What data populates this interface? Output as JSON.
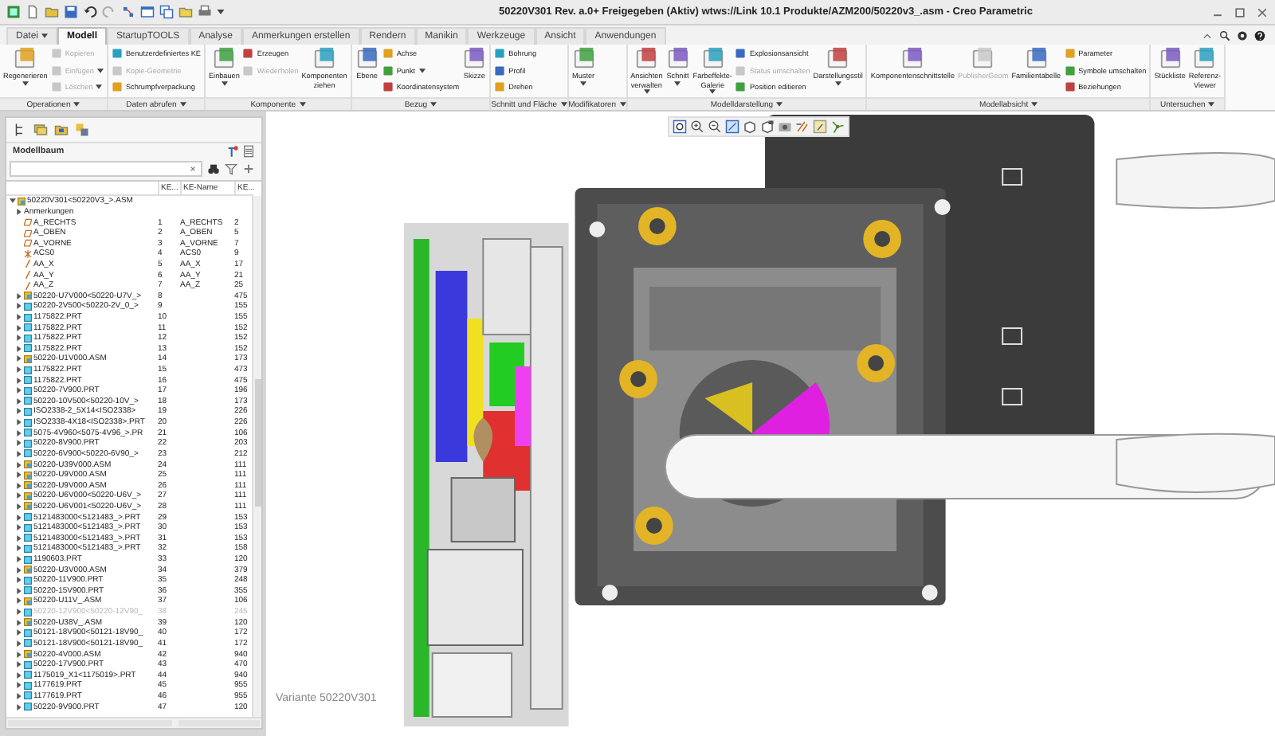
{
  "window": {
    "title": "50220V301 Rev. a.0+ Freigegeben (Aktiv) wtws://Link 10.1 Produkte/AZM200/50220v3_.asm - Creo Parametric"
  },
  "tabs": [
    {
      "label": "Datei",
      "selected": false,
      "dropdown": true
    },
    {
      "label": "Modell",
      "selected": true,
      "dropdown": false
    },
    {
      "label": "StartupTOOLS",
      "selected": false,
      "dropdown": false
    },
    {
      "label": "Analyse",
      "selected": false,
      "dropdown": false
    },
    {
      "label": "Anmerkungen erstellen",
      "selected": false,
      "dropdown": false
    },
    {
      "label": "Rendern",
      "selected": false,
      "dropdown": false
    },
    {
      "label": "Manikin",
      "selected": false,
      "dropdown": false
    },
    {
      "label": "Werkzeuge",
      "selected": false,
      "dropdown": false
    },
    {
      "label": "Ansicht",
      "selected": false,
      "dropdown": false
    },
    {
      "label": "Anwendungen",
      "selected": false,
      "dropdown": false
    }
  ],
  "ribbon": {
    "groups": [
      {
        "label": "Operationen",
        "commands": [
          {
            "label": "Regenerieren",
            "kind": "large",
            "disabled": false,
            "dropdown": true
          },
          {
            "label": "Kopieren",
            "kind": "small",
            "disabled": true,
            "dropdown": false
          },
          {
            "label": "Einfügen",
            "kind": "small",
            "disabled": true,
            "dropdown": true
          },
          {
            "label": "Löschen",
            "kind": "small",
            "disabled": true,
            "dropdown": true
          }
        ]
      },
      {
        "label": "Daten abrufen",
        "commands": [
          {
            "label": "Benutzerdefiniertes KE",
            "kind": "small",
            "disabled": false,
            "dropdown": false
          },
          {
            "label": "Kopie-Geometrie",
            "kind": "small",
            "disabled": true,
            "dropdown": false
          },
          {
            "label": "Schrumpfverpackung",
            "kind": "small",
            "disabled": false,
            "dropdown": false
          }
        ]
      },
      {
        "label": "Komponente",
        "commands": [
          {
            "label": "Einbauen",
            "kind": "large",
            "disabled": false,
            "dropdown": true
          },
          {
            "label": "Erzeugen",
            "kind": "small",
            "disabled": false,
            "dropdown": false
          },
          {
            "label": "Wiederholen",
            "kind": "small",
            "disabled": true,
            "dropdown": false
          },
          {
            "label": "Komponenten ziehen",
            "kind": "large",
            "disabled": false,
            "dropdown": false
          }
        ]
      },
      {
        "label": "Bezug",
        "commands": [
          {
            "label": "Ebene",
            "kind": "large",
            "disabled": false,
            "dropdown": false
          },
          {
            "label": "Achse",
            "kind": "small",
            "disabled": false,
            "dropdown": false
          },
          {
            "label": "Punkt",
            "kind": "small",
            "disabled": false,
            "dropdown": true
          },
          {
            "label": "Koordinatensystem",
            "kind": "small",
            "disabled": false,
            "dropdown": false
          },
          {
            "label": "Skizze",
            "kind": "large",
            "disabled": false,
            "dropdown": false
          }
        ]
      },
      {
        "label": "Schnitt und Fläche",
        "commands": [
          {
            "label": "Bohrung",
            "kind": "small",
            "disabled": false,
            "dropdown": false
          },
          {
            "label": "Profil",
            "kind": "small",
            "disabled": false,
            "dropdown": false
          },
          {
            "label": "Drehen",
            "kind": "small",
            "disabled": false,
            "dropdown": false
          }
        ]
      },
      {
        "label": "Modifikatoren",
        "commands": [
          {
            "label": "Muster",
            "kind": "large",
            "disabled": false,
            "dropdown": true
          }
        ]
      },
      {
        "label": "Modelldarstellung",
        "commands": [
          {
            "label": "Ansichten verwalten",
            "kind": "large",
            "disabled": false,
            "dropdown": true
          },
          {
            "label": "Schnitt",
            "kind": "large",
            "disabled": false,
            "dropdown": true
          },
          {
            "label": "Farbeffekte-Galerie",
            "kind": "large",
            "disabled": false,
            "dropdown": true
          },
          {
            "label": "Explosionsansicht",
            "kind": "small",
            "disabled": false,
            "dropdown": false
          },
          {
            "label": "Status umschalten",
            "kind": "small",
            "disabled": true,
            "dropdown": false
          },
          {
            "label": "Position editieren",
            "kind": "small",
            "disabled": false,
            "dropdown": false
          },
          {
            "label": "Darstellungsstil",
            "kind": "large",
            "disabled": false,
            "dropdown": true
          }
        ]
      },
      {
        "label": "Modellabsicht",
        "commands": [
          {
            "label": "Komponentenschnittstelle",
            "kind": "large",
            "disabled": false,
            "dropdown": false
          },
          {
            "label": "PublisherGeom",
            "kind": "large",
            "disabled": true,
            "dropdown": false
          },
          {
            "label": "Familientabelle",
            "kind": "large",
            "disabled": false,
            "dropdown": false
          },
          {
            "label": "Parameter",
            "kind": "small",
            "disabled": false,
            "dropdown": false
          },
          {
            "label": "Symbole umschalten",
            "kind": "small",
            "disabled": false,
            "dropdown": false
          },
          {
            "label": "Beziehungen",
            "kind": "small",
            "disabled": false,
            "dropdown": false
          }
        ]
      },
      {
        "label": "Untersuchen",
        "commands": [
          {
            "label": "Stückliste",
            "kind": "large",
            "disabled": false,
            "dropdown": false
          },
          {
            "label": "Referenz-Viewer",
            "kind": "large",
            "disabled": false,
            "dropdown": false
          }
        ]
      }
    ]
  },
  "model_tree": {
    "title": "Modellbaum",
    "columns": [
      "KE...",
      "KE-Name",
      "KE..."
    ],
    "root": {
      "kind": "asm",
      "label": "50220V301<50220V3_>.ASM",
      "expanded": true,
      "dimmed": false,
      "children": [
        {
          "kind": "folder",
          "label": "Anmerkungen",
          "expanded": false,
          "dimmed": false
        },
        {
          "kind": "plane",
          "label": "A_RECHTS",
          "number": "1",
          "feature_name": "A_RECHTS",
          "column_3": "2",
          "dimmed": false
        },
        {
          "kind": "plane",
          "label": "A_OBEN",
          "number": "2",
          "feature_name": "A_OBEN",
          "column_3": "5",
          "dimmed": false
        },
        {
          "kind": "plane",
          "label": "A_VORNE",
          "number": "3",
          "feature_name": "A_VORNE",
          "column_3": "7",
          "dimmed": false
        },
        {
          "kind": "csys",
          "label": "ACS0",
          "number": "4",
          "feature_name": "ACS0",
          "column_3": "9",
          "dimmed": false
        },
        {
          "kind": "axis",
          "label": "AA_X",
          "number": "5",
          "feature_name": "AA_X",
          "column_3": "17",
          "dimmed": false
        },
        {
          "kind": "axis",
          "label": "AA_Y",
          "number": "6",
          "feature_name": "AA_Y",
          "column_3": "21",
          "dimmed": false
        },
        {
          "kind": "axis",
          "label": "AA_Z",
          "number": "7",
          "feature_name": "AA_Z",
          "column_3": "25",
          "dimmed": false
        },
        {
          "kind": "asm",
          "label": "50220-U7V000<50220-U7V_>",
          "number": "8",
          "column_3": "475",
          "expanded": false,
          "dimmed": false
        },
        {
          "kind": "prt",
          "label": "50220-2V500<50220-2V_0_>",
          "number": "9",
          "column_3": "155",
          "expanded": false,
          "dimmed": false
        },
        {
          "kind": "prt",
          "label": "1175822.PRT",
          "number": "10",
          "column_3": "155",
          "expanded": false,
          "dimmed": false
        },
        {
          "kind": "prt",
          "label": "1175822.PRT",
          "number": "11",
          "column_3": "152",
          "expanded": false,
          "dimmed": false
        },
        {
          "kind": "prt",
          "label": "1175822.PRT",
          "number": "12",
          "column_3": "152",
          "expanded": false,
          "dimmed": false
        },
        {
          "kind": "prt",
          "label": "1175822.PRT",
          "number": "13",
          "column_3": "152",
          "expanded": false,
          "dimmed": false
        },
        {
          "kind": "asm",
          "label": "50220-U1V000.ASM",
          "number": "14",
          "column_3": "173",
          "expanded": false,
          "dimmed": false
        },
        {
          "kind": "prt",
          "label": "1175822.PRT",
          "number": "15",
          "column_3": "473",
          "expanded": false,
          "dimmed": false
        },
        {
          "kind": "prt",
          "label": "1175822.PRT",
          "number": "16",
          "column_3": "475",
          "expanded": false,
          "dimmed": false
        },
        {
          "kind": "prt",
          "label": "50220-7V900.PRT",
          "number": "17",
          "column_3": "196",
          "expanded": false,
          "dimmed": false
        },
        {
          "kind": "prt",
          "label": "50220-10V500<50220-10V_>",
          "number": "18",
          "column_3": "173",
          "expanded": false,
          "dimmed": false
        },
        {
          "kind": "prt",
          "label": "ISO2338-2_5X14<ISO2338>",
          "number": "19",
          "column_3": "226",
          "expanded": false,
          "dimmed": false
        },
        {
          "kind": "prt",
          "label": "ISO2338-4X18<ISO2338>.PRT",
          "number": "20",
          "column_3": "226",
          "expanded": false,
          "dimmed": false
        },
        {
          "kind": "prt",
          "label": "5075-4V960<5075-4V96_>.PR",
          "number": "21",
          "column_3": "106",
          "expanded": false,
          "dimmed": false
        },
        {
          "kind": "prt",
          "label": "50220-8V900.PRT",
          "number": "22",
          "column_3": "203",
          "expanded": false,
          "dimmed": false
        },
        {
          "kind": "prt",
          "label": "50220-6V900<50220-6V90_>",
          "number": "23",
          "column_3": "212",
          "expanded": false,
          "dimmed": false
        },
        {
          "kind": "asm",
          "label": "50220-U39V000.ASM",
          "number": "24",
          "column_3": "111",
          "expanded": false,
          "dimmed": false
        },
        {
          "kind": "asm",
          "label": "50220-U9V000.ASM",
          "number": "25",
          "column_3": "111",
          "expanded": false,
          "dimmed": false
        },
        {
          "kind": "asm",
          "label": "50220-U9V000.ASM",
          "number": "26",
          "column_3": "111",
          "expanded": false,
          "dimmed": false
        },
        {
          "kind": "asm",
          "label": "50220-U6V000<50220-U6V_>",
          "number": "27",
          "column_3": "111",
          "expanded": false,
          "dimmed": false
        },
        {
          "kind": "asm",
          "label": "50220-U6V001<50220-U6V_>",
          "number": "28",
          "column_3": "111",
          "expanded": false,
          "dimmed": false
        },
        {
          "kind": "prt",
          "label": "5121483000<5121483_>.PRT",
          "number": "29",
          "column_3": "153",
          "expanded": false,
          "dimmed": false
        },
        {
          "kind": "prt",
          "label": "5121483000<5121483_>.PRT",
          "number": "30",
          "column_3": "153",
          "expanded": false,
          "dimmed": false
        },
        {
          "kind": "prt",
          "label": "5121483000<5121483_>.PRT",
          "number": "31",
          "column_3": "153",
          "expanded": false,
          "dimmed": false
        },
        {
          "kind": "prt",
          "label": "5121483000<5121483_>.PRT",
          "number": "32",
          "column_3": "158",
          "expanded": false,
          "dimmed": false
        },
        {
          "kind": "prt",
          "label": "1190603.PRT",
          "number": "33",
          "column_3": "120",
          "expanded": false,
          "dimmed": false
        },
        {
          "kind": "asm",
          "label": "50220-U3V000.ASM",
          "number": "34",
          "column_3": "379",
          "expanded": false,
          "dimmed": false
        },
        {
          "kind": "prt",
          "label": "50220-11V900.PRT",
          "number": "35",
          "column_3": "248",
          "expanded": false,
          "dimmed": false
        },
        {
          "kind": "prt",
          "label": "50220-15V900.PRT",
          "number": "36",
          "column_3": "355",
          "expanded": false,
          "dimmed": false
        },
        {
          "kind": "asm",
          "label": "50220-U11V_.ASM",
          "number": "37",
          "column_3": "106",
          "expanded": false,
          "dimmed": false
        },
        {
          "kind": "prt",
          "label": "50220-12V900<50220-12V90_",
          "number": "38",
          "column_3": "245",
          "expanded": false,
          "dimmed": true
        },
        {
          "kind": "asm",
          "label": "50220-U38V_.ASM",
          "number": "39",
          "column_3": "120",
          "expanded": false,
          "dimmed": false
        },
        {
          "kind": "prt",
          "label": "50121-18V900<50121-18V90_",
          "number": "40",
          "column_3": "172",
          "expanded": false,
          "dimmed": false
        },
        {
          "kind": "prt",
          "label": "50121-18V900<50121-18V90_",
          "number": "41",
          "column_3": "172",
          "expanded": false,
          "dimmed": false
        },
        {
          "kind": "asm",
          "label": "50220-4V000.ASM",
          "number": "42",
          "column_3": "940",
          "expanded": false,
          "dimmed": false
        },
        {
          "kind": "prt",
          "label": "50220-17V900.PRT",
          "number": "43",
          "column_3": "470",
          "expanded": false,
          "dimmed": false
        },
        {
          "kind": "prt",
          "label": "1175019_X1<1175019>.PRT",
          "number": "44",
          "column_3": "940",
          "expanded": false,
          "dimmed": false
        },
        {
          "kind": "prt",
          "label": "1177619.PRT",
          "number": "45",
          "column_3": "955",
          "expanded": false,
          "dimmed": false
        },
        {
          "kind": "prt",
          "label": "1177619.PRT",
          "number": "46",
          "column_3": "955",
          "expanded": false,
          "dimmed": false
        },
        {
          "kind": "prt",
          "label": "50220-9V900.PRT",
          "number": "47",
          "column_3": "120",
          "expanded": false,
          "dimmed": false
        }
      ]
    }
  },
  "viewport": {
    "caption": "Variante 50220V301"
  }
}
